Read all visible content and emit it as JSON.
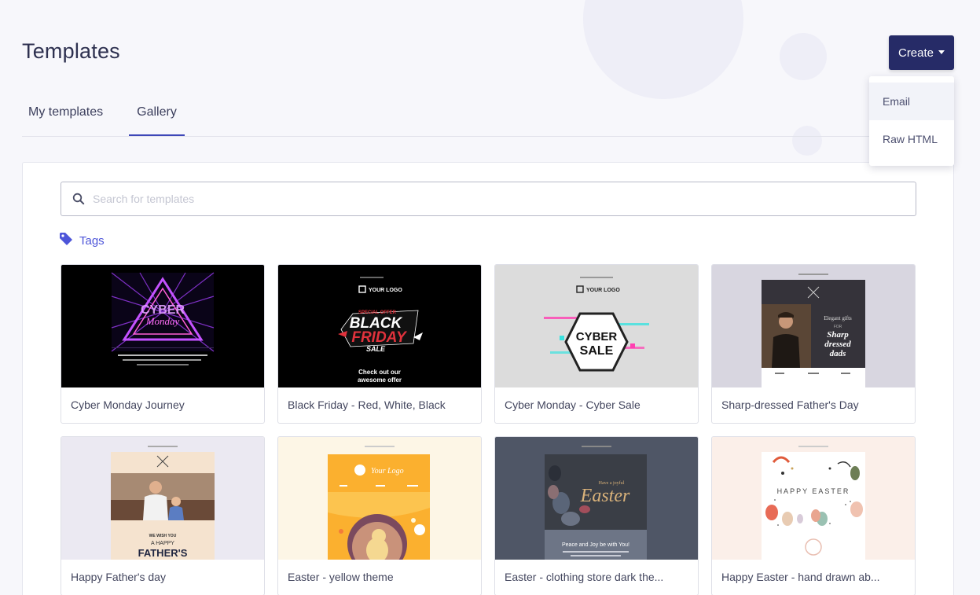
{
  "page": {
    "title": "Templates",
    "create_label": "Create",
    "dropdown": [
      "Email",
      "Raw HTML"
    ]
  },
  "tabs": [
    {
      "label": "My templates",
      "active": false
    },
    {
      "label": "Gallery",
      "active": true
    }
  ],
  "search": {
    "placeholder": "Search for templates"
  },
  "tags_label": "Tags",
  "templates": [
    {
      "name": "Cyber Monday Journey"
    },
    {
      "name": "Black Friday - Red, White, Black"
    },
    {
      "name": "Cyber Monday - Cyber Sale"
    },
    {
      "name": "Sharp-dressed Father's Day"
    },
    {
      "name": "Happy Father's day"
    },
    {
      "name": "Easter - yellow theme"
    },
    {
      "name": "Easter - clothing store dark the..."
    },
    {
      "name": "Happy Easter - hand drawn ab..."
    }
  ],
  "thumbnails": {
    "cyber_sale": "CYBER SALE",
    "your_logo": "YOUR LOGO",
    "black": "BLACK",
    "friday": "FRIDAY",
    "sale": "SALE",
    "special_offer": "SPECIAL OFFER",
    "check_out": "Check out our",
    "awesome": "awesome offer",
    "elegant": "Elegant gifts",
    "for": "FOR",
    "sharp": "Sharp",
    "dressed": "dressed",
    "dads": "dads",
    "we_wish": "WE WISH YOU",
    "a_happy": "A HAPPY",
    "fathers": "FATHER'S",
    "your_logo_script": "Your Logo",
    "easter": "Easter",
    "peace": "Peace and Joy be with You!",
    "happy_easter": "HAPPY EASTER"
  },
  "colors": {
    "primary": "#262b67",
    "accent": "#4d55d9",
    "tab_underline": "#3e47b8"
  }
}
